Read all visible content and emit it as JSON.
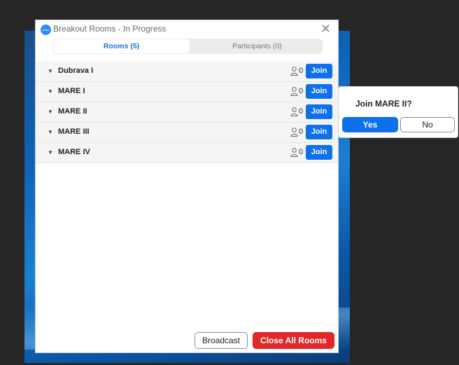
{
  "window": {
    "title": "Breakout Rooms - In Progress",
    "app_icon_text": "zoom",
    "close_glyph": "✕"
  },
  "tabs": [
    {
      "label": "Rooms (5)",
      "active": true
    },
    {
      "label": "Participants (0)",
      "active": false
    }
  ],
  "rooms": [
    {
      "name": "Dubrava I",
      "count": "0",
      "join_label": "Join"
    },
    {
      "name": "MARE I",
      "count": "0",
      "join_label": "Join"
    },
    {
      "name": "MARE II",
      "count": "0",
      "join_label": "Join"
    },
    {
      "name": "MARE III",
      "count": "0",
      "join_label": "Join"
    },
    {
      "name": "MARE IV",
      "count": "0",
      "join_label": "Join"
    }
  ],
  "footer": {
    "broadcast_label": "Broadcast",
    "close_all_label": "Close All Rooms"
  },
  "popup": {
    "title": "Join MARE II?",
    "yes_label": "Yes",
    "no_label": "No"
  },
  "icons": {
    "caret": "caret-down-icon",
    "person": "person-icon"
  },
  "colors": {
    "accent": "#0e71eb",
    "danger": "#e02828",
    "tab_active_text": "#1f72d8"
  }
}
